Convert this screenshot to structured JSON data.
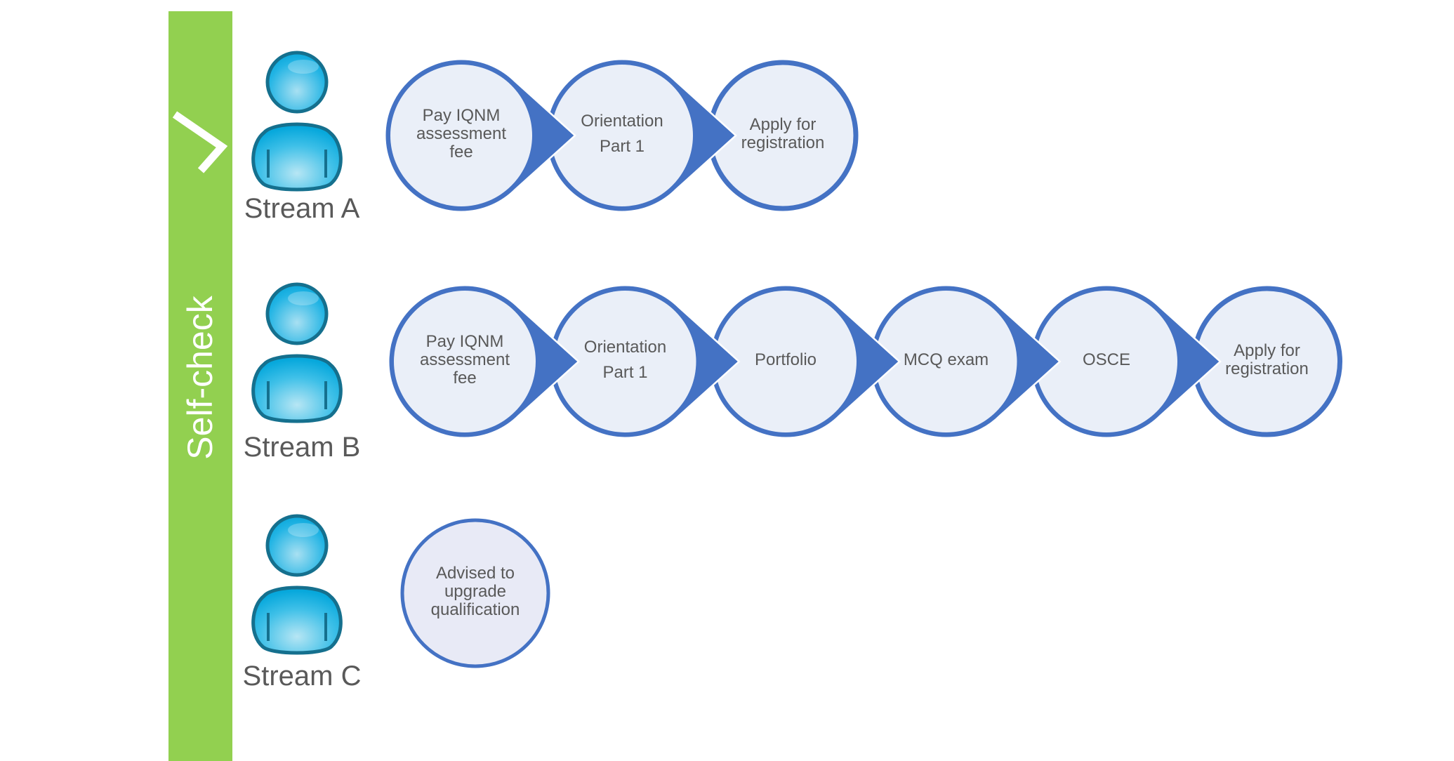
{
  "sidebar": {
    "label": "Self-check",
    "color": "#92d050",
    "icon": "chevron-right-icon"
  },
  "colors": {
    "node_border": "#4472c4",
    "node_fill": "#eaeff8",
    "node_fill_alt": "#e8eaf6",
    "text": "#595959"
  },
  "streams": [
    {
      "label": "Stream A",
      "icon": "person-icon",
      "steps": [
        {
          "label": "Pay IQNM\nassessment\nfee"
        },
        {
          "label": "Orientation\n\nPart 1"
        },
        {
          "label": "Apply for\nregistration"
        }
      ]
    },
    {
      "label": "Stream B",
      "icon": "person-icon",
      "steps": [
        {
          "label": "Pay IQNM\nassessment\nfee"
        },
        {
          "label": "Orientation\n\nPart 1"
        },
        {
          "label": "Portfolio"
        },
        {
          "label": "MCQ exam"
        },
        {
          "label": "OSCE"
        },
        {
          "label": "Apply for\nregistration"
        }
      ]
    },
    {
      "label": "Stream C",
      "icon": "person-icon",
      "steps": [
        {
          "label": "Advised to\nupgrade\nqualification"
        }
      ]
    }
  ]
}
